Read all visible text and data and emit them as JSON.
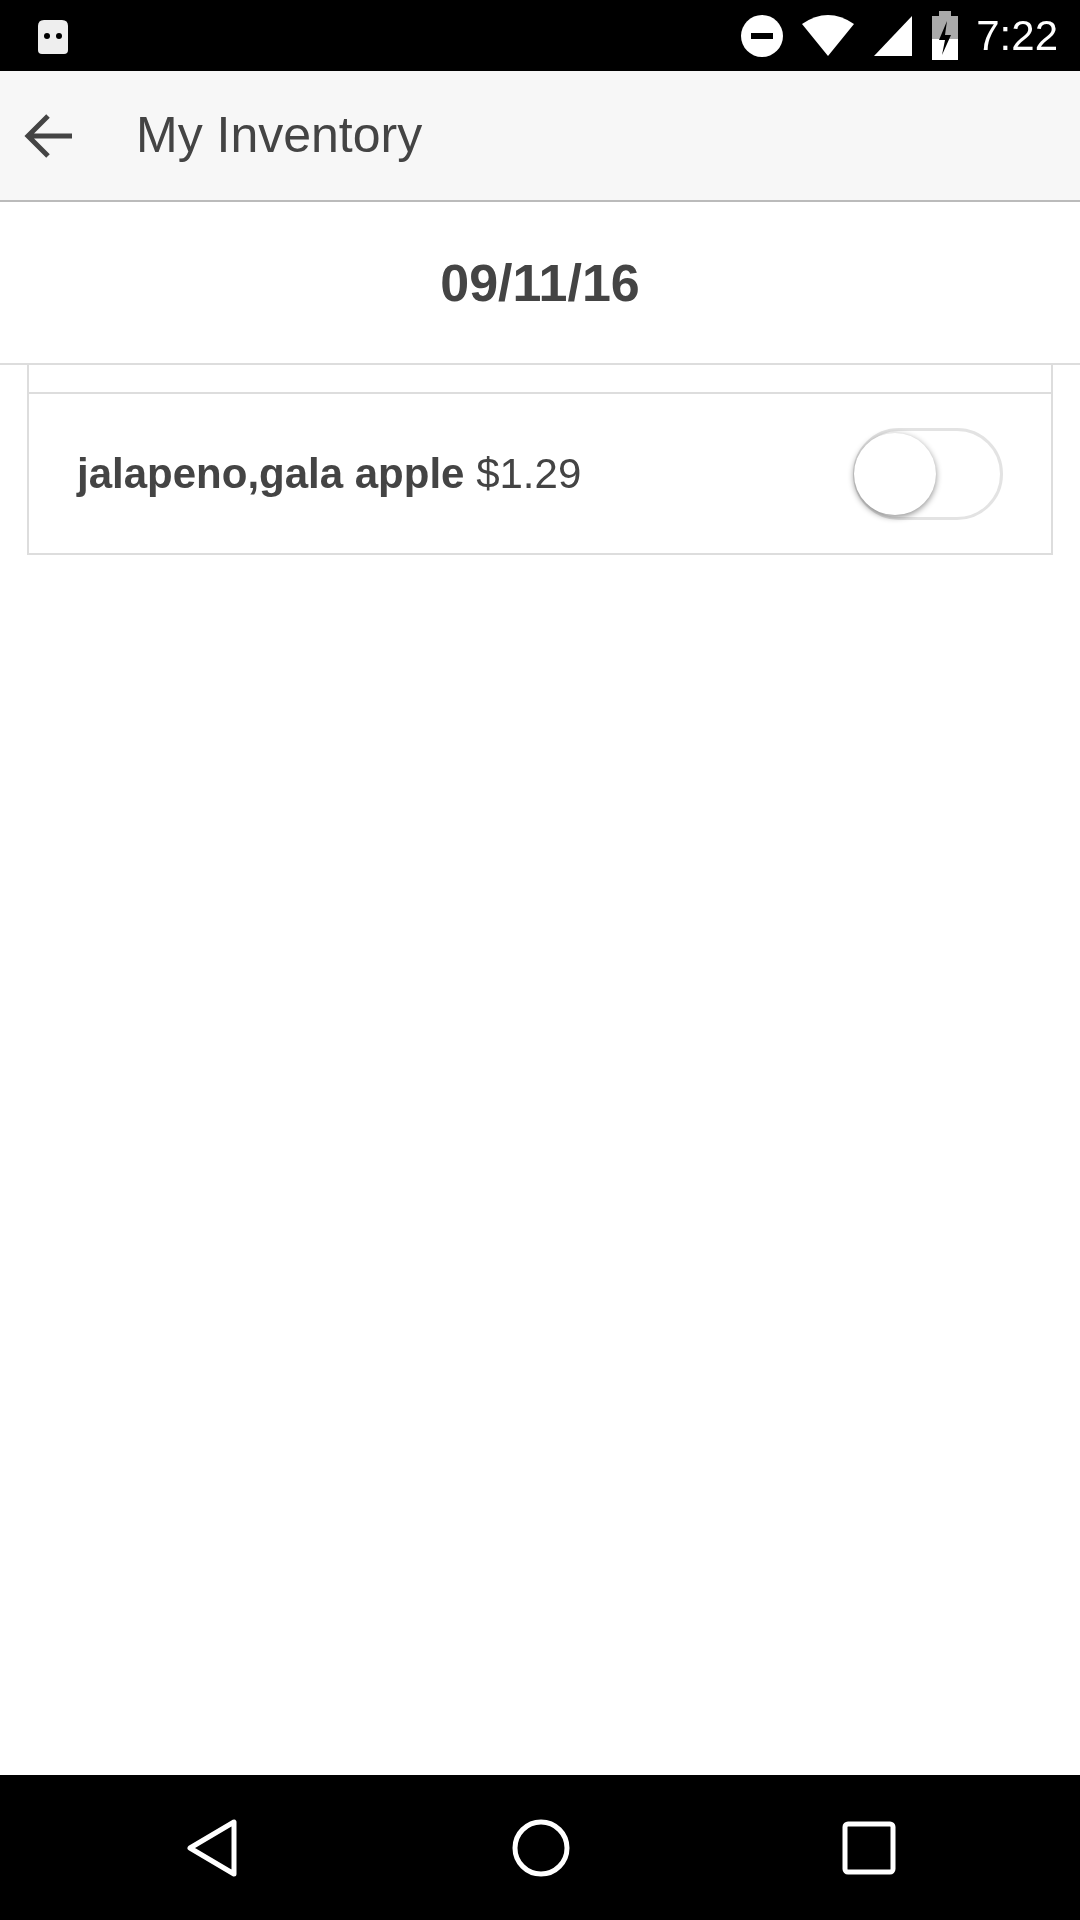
{
  "status_bar": {
    "time": "7:22"
  },
  "app_bar": {
    "title": "My Inventory"
  },
  "date": "09/11/16",
  "items": [
    {
      "label": "**jalapeno,gala apple** $1.29",
      "on": false
    }
  ]
}
